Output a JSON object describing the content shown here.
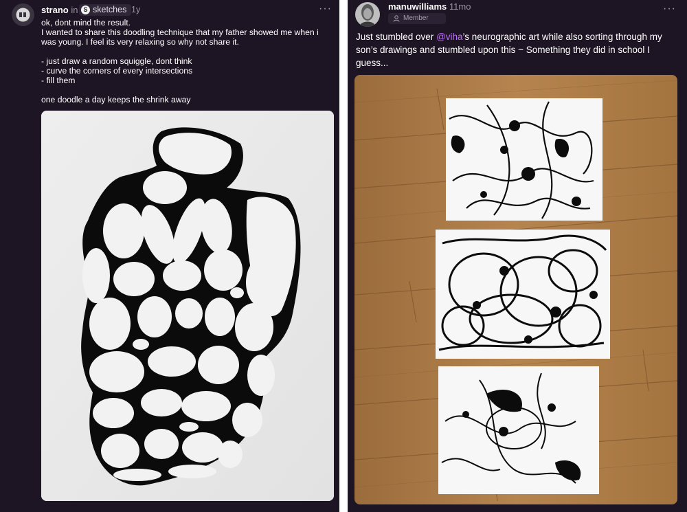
{
  "left_post": {
    "author": "strano",
    "in_word": "in",
    "community": {
      "icon_letter": "S",
      "name": "sketches"
    },
    "time": "1y",
    "more_label": "···",
    "text": "ok, dont mind the result.\nI wanted to share this doodling technique that my father showed me when i\nwas young. I feel its very relaxing so why not share it.\n\n- just draw a random squiggle, dont think\n- curve the corners of every intersections\n- fill them\n\none doodle a day keeps the shrink away",
    "image_icon": "doodle-drawing-image"
  },
  "right_post": {
    "author": "manuwilliams",
    "time": "11mo",
    "badge": "Member",
    "badge_icon": "person-icon",
    "more_label": "···",
    "text_before": "Just stumbled over ",
    "mention": "@viha",
    "text_after": "’s neurographic art while also sorting through my son’s drawings and stumbled upon this ~ Something they did in school I guess...",
    "image_icon": "drawings-on-floor-photo"
  },
  "colors": {
    "background": "#1e1524",
    "divider": "#ffffff",
    "mention": "#c06cff",
    "muted_text": "#9b92a3",
    "wood_floor": "#ad7c4a"
  }
}
